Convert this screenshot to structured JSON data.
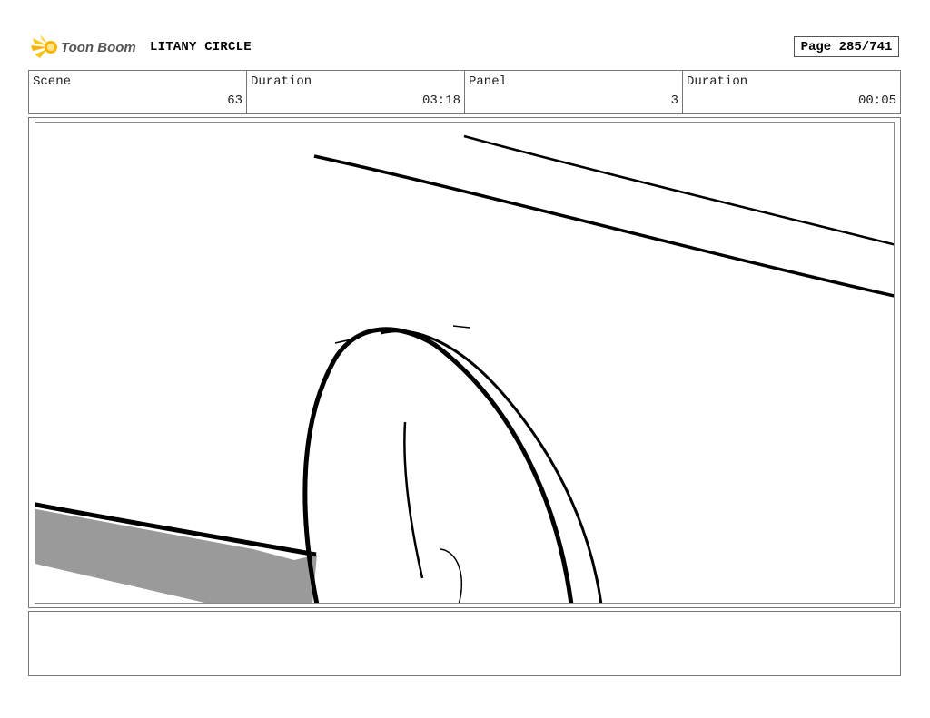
{
  "header": {
    "logo_text": "Toon Boom",
    "project_title": "LITANY CIRCLE",
    "page_label": "Page 285/741"
  },
  "info": {
    "scene_label": "Scene",
    "scene_value": "63",
    "scene_duration_label": "Duration",
    "scene_duration_value": "03:18",
    "panel_label": "Panel",
    "panel_value": "3",
    "panel_duration_label": "Duration",
    "panel_duration_value": "00:05"
  },
  "notes": {
    "text": ""
  }
}
